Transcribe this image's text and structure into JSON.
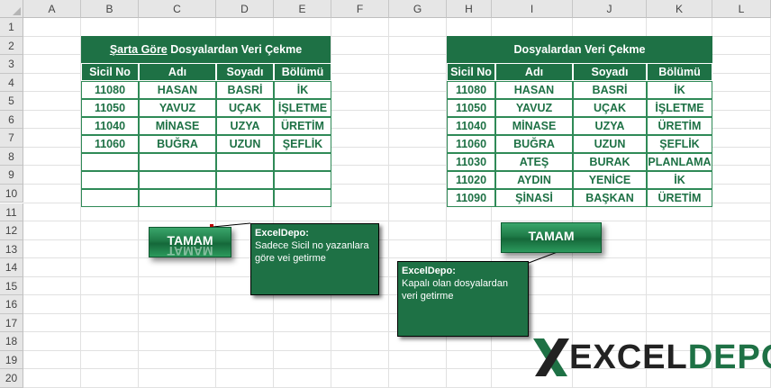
{
  "columns": [
    "A",
    "B",
    "C",
    "D",
    "E",
    "F",
    "G",
    "H",
    "I",
    "J",
    "K",
    "L"
  ],
  "rows": [
    "1",
    "2",
    "3",
    "4",
    "5",
    "6",
    "7",
    "8",
    "9",
    "10",
    "11",
    "12",
    "13",
    "14",
    "15",
    "16",
    "17",
    "18",
    "19",
    "20"
  ],
  "left_table": {
    "title_part1": "Şarta Göre",
    "title_part2": " Dosyalardan Veri Çekme",
    "headers": [
      "Sicil No",
      "Adı",
      "Soyadı",
      "Bölümü"
    ],
    "rows": [
      [
        "11080",
        "HASAN",
        "BASRİ",
        "İK"
      ],
      [
        "11050",
        "YAVUZ",
        "UÇAK",
        "İŞLETME"
      ],
      [
        "11040",
        "MİNASE",
        "UZYA",
        "ÜRETİM"
      ],
      [
        "11060",
        "BUĞRA",
        "UZUN",
        "ŞEFLİK"
      ],
      [
        "",
        "",
        "",
        ""
      ],
      [
        "",
        "",
        "",
        ""
      ],
      [
        "",
        "",
        "",
        ""
      ]
    ]
  },
  "right_table": {
    "title": "Dosyalardan Veri Çekme",
    "headers": [
      "Sicil No",
      "Adı",
      "Soyadı",
      "Bölümü"
    ],
    "rows": [
      [
        "11080",
        "HASAN",
        "BASRİ",
        "İK"
      ],
      [
        "11050",
        "YAVUZ",
        "UÇAK",
        "İŞLETME"
      ],
      [
        "11040",
        "MİNASE",
        "UZYA",
        "ÜRETİM"
      ],
      [
        "11060",
        "BUĞRA",
        "UZUN",
        "ŞEFLİK"
      ],
      [
        "11030",
        "ATEŞ",
        "BURAK",
        "PLANLAMA"
      ],
      [
        "11020",
        "AYDIN",
        "YENİCE",
        "İK"
      ],
      [
        "11090",
        "ŞİNASİ",
        "BAŞKAN",
        "ÜRETİM"
      ]
    ]
  },
  "buttons": {
    "left_label": "TAMAM",
    "right_label": "TAMAM"
  },
  "notes": {
    "left_title": "ExcelDepo:",
    "left_text": "Sadece Sicil no yazanlara göre vei getirme",
    "right_title": "ExcelDepo:",
    "right_text": "Kapalı olan dosyalardan veri getirme"
  },
  "logo": {
    "text_a": "EXCEL",
    "text_b": "DEPO",
    "color_a": "#222222",
    "color_b": "#1e7145"
  }
}
